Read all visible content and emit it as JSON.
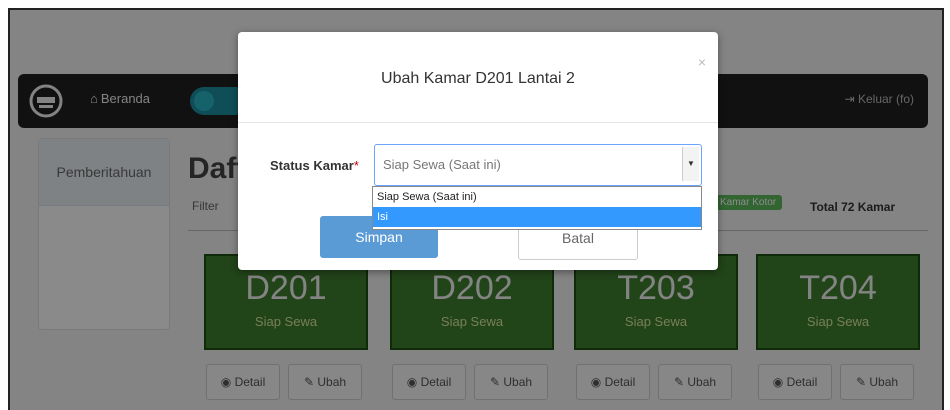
{
  "navbar": {
    "home_label": "Beranda",
    "logout_label": "Keluar (fo)"
  },
  "sidebar": {
    "items": [
      {
        "label": "Pemberitahuan"
      }
    ]
  },
  "main": {
    "title": "Daft",
    "filter_label": "Filter",
    "status_badge": "Kamar Kotor",
    "total_label": "Total 72 Kamar"
  },
  "rooms": [
    {
      "code": "D201",
      "status": "Siap Sewa",
      "detail_label": "Detail",
      "edit_label": "Ubah"
    },
    {
      "code": "D202",
      "status": "Siap Sewa",
      "detail_label": "Detail",
      "edit_label": "Ubah"
    },
    {
      "code": "T203",
      "status": "Siap Sewa",
      "detail_label": "Detail",
      "edit_label": "Ubah"
    },
    {
      "code": "T204",
      "status": "Siap Sewa",
      "detail_label": "Detail",
      "edit_label": "Ubah"
    }
  ],
  "modal": {
    "title": "Ubah Kamar D201 Lantai 2",
    "close_label": "×",
    "field_label": "Status Kamar",
    "required_mark": "*",
    "select_value": "Siap Sewa (Saat ini)",
    "options": [
      "Siap Sewa (Saat ini)",
      "Isi"
    ],
    "selected_option_index": 1,
    "save_label": "Simpan",
    "cancel_label": "Batal"
  },
  "colors": {
    "room_tile": "#3e7d2e",
    "primary_button": "#5b9bd5",
    "selected_option": "#3399ff",
    "navbar": "#1f1f1f"
  }
}
